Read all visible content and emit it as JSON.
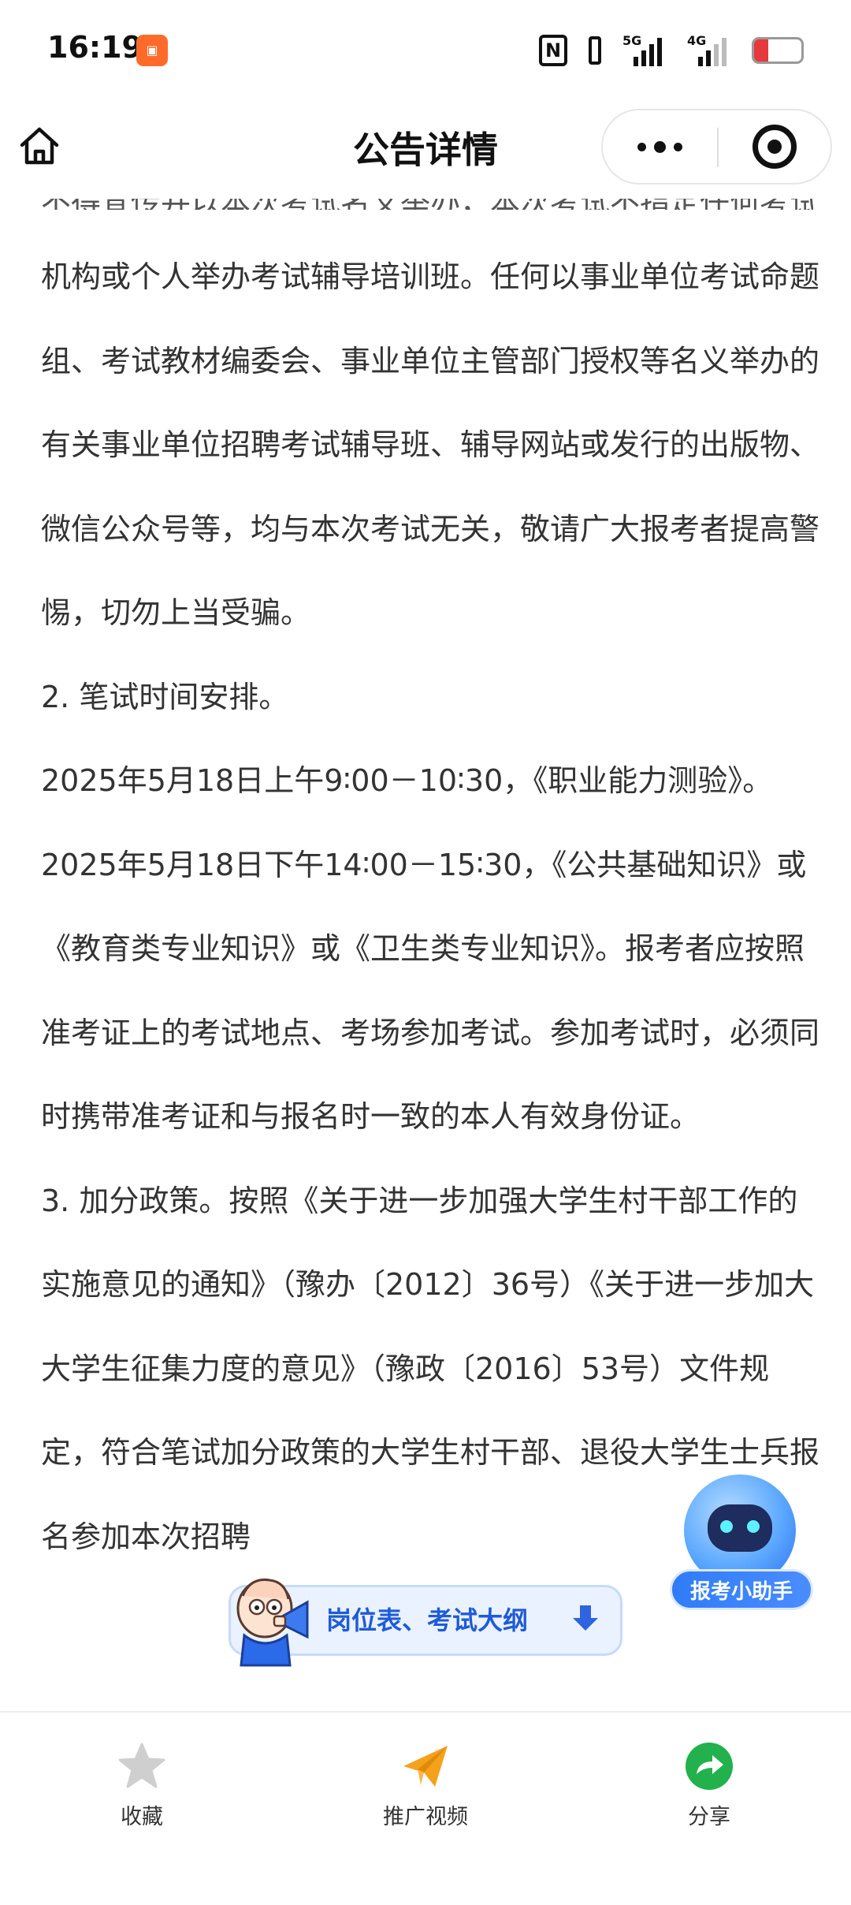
{
  "status_bar": {
    "time": "16:19",
    "app_icon": "orange-app-icon",
    "nfc": "N",
    "network_1": "5G",
    "network_2": "4G",
    "battery": "8"
  },
  "nav": {
    "title": "公告详情",
    "home_icon": "home-icon",
    "more_icon": "more-dots-icon",
    "close_icon": "target-close-icon"
  },
  "content": {
    "partial_line": "不得宣传并以本次考试名义举办，本次考试不指定任何考试辅导用书",
    "paragraphs": [
      "机构或个人举办考试辅导培训班。任何以事业单位考试命题组、考试教材编委会、事业单位主管部门授权等名义举办的有关事业单位招聘考试辅导班、辅导网站或发行的出版物、微信公众号等，均与本次考试无关，敬请广大报考者提高警惕，切勿上当受骗。",
      "2. 笔试时间安排。",
      "2025年5月18日上午9∶00－10∶30，《职业能力测验》。",
      "2025年5月18日下午14∶00－15∶30，《公共基础知识》或《教育类专业知识》或《卫生类专业知识》。报考者应按照准考证上的考试地点、考场参加考试。参加考试时，必须同时携带准考证和与报名时一致的本人有效身份证。",
      "3. 加分政策。按照《关于进一步加强大学生村干部工作的实施意见的通知》（豫办〔2012〕36号）《关于进一步加大大学生征集力度的意见》（豫政〔2016〕53号）文件规定，符合笔试加分政策的大学生村干部、退役大学生士兵报名参加本次招聘"
    ]
  },
  "assistant": {
    "label": "报考小助手",
    "icon": "robot-icon"
  },
  "promo": {
    "label": "岗位表、考试大纲",
    "arrow_icon": "download-arrow-icon",
    "mascot_icon": "megaphone-mascot-icon"
  },
  "tabbar": {
    "items": [
      {
        "label": "收藏",
        "icon": "star-icon"
      },
      {
        "label": "推广视频",
        "icon": "paper-plane-icon"
      },
      {
        "label": "分享",
        "icon": "share-arrow-icon"
      }
    ]
  },
  "colors": {
    "accent_blue": "#2f7cf6",
    "promo_text": "#1f5bd8",
    "plane_orange": "#f5a11c",
    "share_green": "#22b14c",
    "star_gray": "#cfcfcf",
    "battery_red": "#e5393d"
  }
}
